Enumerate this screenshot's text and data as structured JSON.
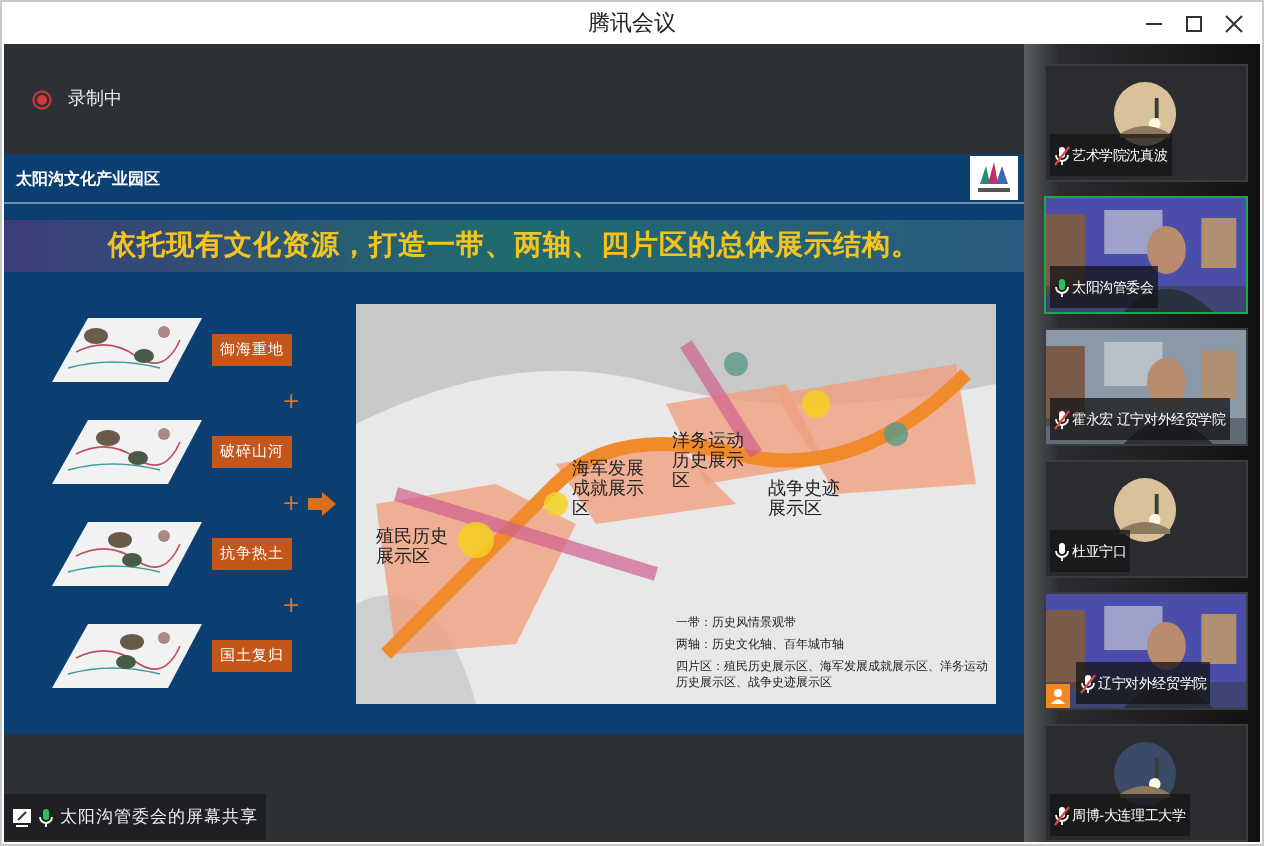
{
  "window": {
    "title": "腾讯会议"
  },
  "recording": {
    "label": "录制中",
    "on": true
  },
  "slide": {
    "header": "太阳沟文化产业园区",
    "headline": "依托现有文化资源，打造一带、两轴、四片区的总体展示结构。",
    "layers": [
      {
        "label": "御海重地",
        "plus": "+"
      },
      {
        "label": "破碎山河",
        "plus": "+"
      },
      {
        "label": "抗争热土",
        "plus": "+"
      },
      {
        "label": "国土复归"
      }
    ],
    "map": {
      "zones": [
        {
          "label": "殖民历史展示区"
        },
        {
          "label": "海军发展成就展示区"
        },
        {
          "label": "洋务运动历史展示区"
        },
        {
          "label": "战争史迹展示区"
        }
      ],
      "legend": [
        "一带：历史风情景观带",
        "两轴：历史文化轴、百年城市轴",
        "四片区：殖民历史展示区、海军发展成就展示区、洋务运动历史展示区、战争史迹展示区"
      ]
    }
  },
  "share": {
    "label": "太阳沟管委会的屏幕共享",
    "muted": false
  },
  "participants": [
    {
      "name": "艺术学院沈真波",
      "kind": "avatar",
      "muted": true,
      "speaking": false,
      "badge": false
    },
    {
      "name": "太阳沟管委会",
      "kind": "video",
      "muted": false,
      "speaking": true,
      "badge": false
    },
    {
      "name": "霍永宏 辽宁对外经贸学院",
      "kind": "video",
      "muted": true,
      "speaking": false,
      "badge": false
    },
    {
      "name": "杜亚宁口",
      "kind": "avatar",
      "muted": false,
      "speaking": false,
      "badge": false
    },
    {
      "name": "辽宁对外经贸学院",
      "kind": "video",
      "muted": true,
      "speaking": false,
      "badge": true
    },
    {
      "name": "周博-大连理工大学",
      "kind": "avatar",
      "muted": true,
      "speaking": false,
      "badge": false
    }
  ]
}
